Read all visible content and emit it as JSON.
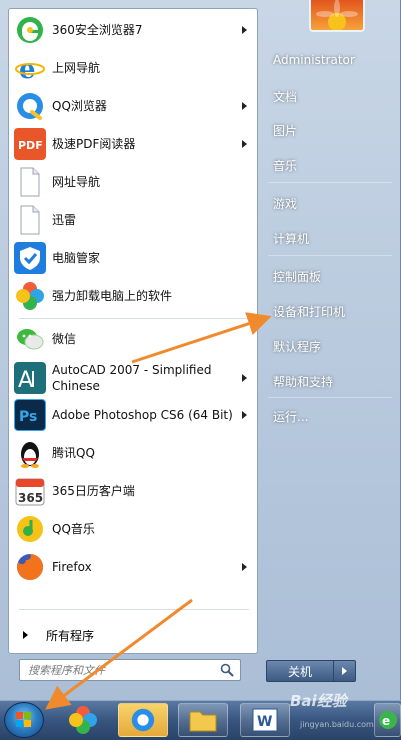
{
  "start_menu": {
    "pinned": [
      {
        "label": "360安全浏览器7",
        "icon": "360-browser-icon",
        "has_submenu": true
      },
      {
        "label": "上网导航",
        "icon": "ie-navigation-icon",
        "has_submenu": false
      },
      {
        "label": "QQ浏览器",
        "icon": "qq-browser-icon",
        "has_submenu": true
      },
      {
        "label": "极速PDF阅读器",
        "icon": "pdf-reader-icon",
        "has_submenu": true
      },
      {
        "label": "网址导航",
        "icon": "blank-document-icon",
        "has_submenu": false
      },
      {
        "label": "迅雷",
        "icon": "blank-document-icon",
        "has_submenu": false
      },
      {
        "label": "电脑管家",
        "icon": "pc-manager-icon",
        "has_submenu": false
      },
      {
        "label": "强力卸载电脑上的软件",
        "icon": "uninstall-pinwheel-icon",
        "has_submenu": false
      }
    ],
    "recent": [
      {
        "label": "微信",
        "icon": "wechat-icon",
        "has_submenu": false
      },
      {
        "label": "AutoCAD 2007 - Simplified Chinese",
        "icon": "autocad-icon",
        "has_submenu": true
      },
      {
        "label": "Adobe Photoshop CS6 (64 Bit)",
        "icon": "photoshop-icon",
        "has_submenu": true
      },
      {
        "label": "腾讯QQ",
        "icon": "qq-penguin-icon",
        "has_submenu": false
      },
      {
        "label": "365日历客户端",
        "icon": "calendar-365-icon",
        "has_submenu": false
      },
      {
        "label": "QQ音乐",
        "icon": "qq-music-icon",
        "has_submenu": false
      },
      {
        "label": "Firefox",
        "icon": "firefox-icon",
        "has_submenu": true
      }
    ],
    "all_programs": "所有程序",
    "search_placeholder": "搜索程序和文件",
    "right_pane": [
      {
        "label": "Administrator"
      },
      {
        "label": "文档"
      },
      {
        "label": "图片"
      },
      {
        "label": "音乐"
      },
      {
        "label": "游戏"
      },
      {
        "label": "计算机"
      },
      {
        "label": "控制面板"
      },
      {
        "label": "设备和打印机"
      },
      {
        "label": "默认程序"
      },
      {
        "label": "帮助和支持"
      },
      {
        "label": "运行..."
      }
    ],
    "shutdown_label": "关机"
  },
  "taskbar": {
    "items": [
      "start-orb",
      "pinwheel-app",
      "qq-browser",
      "folder-explorer",
      "word-document"
    ]
  },
  "watermark": {
    "text": "Bai经验",
    "url": "jingyan.baidu.com"
  },
  "colors": {
    "annotation_arrow": "#f08a2c",
    "taskbar": "#37557e",
    "start_orb": "#2d7fc4"
  }
}
